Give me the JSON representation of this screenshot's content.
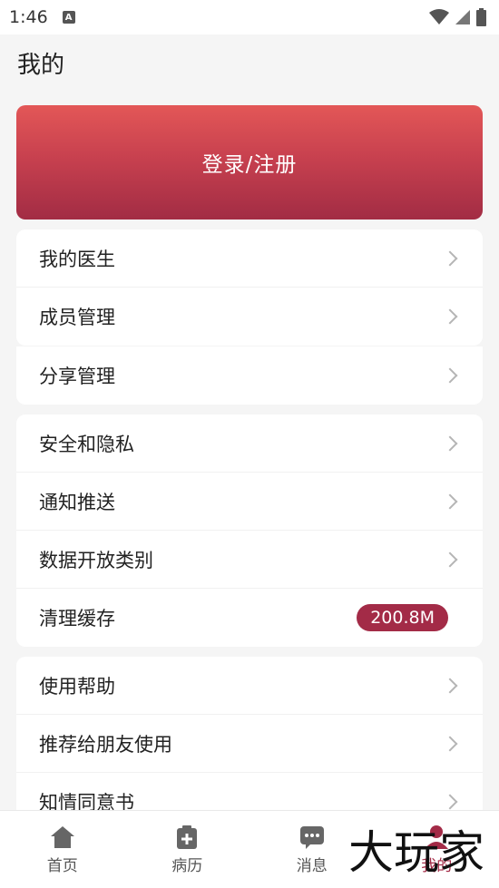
{
  "status_bar": {
    "time": "1:46",
    "notification_icon": "A"
  },
  "page": {
    "title": "我的"
  },
  "login": {
    "label": "登录/注册"
  },
  "menu_group_1": [
    {
      "label": "我的医生",
      "icon": "chevron-right-icon"
    },
    {
      "label": "成员管理",
      "icon": "chevron-right-icon"
    },
    {
      "label": "分享管理",
      "icon": "chevron-right-icon"
    }
  ],
  "menu_group_2": [
    {
      "label": "安全和隐私",
      "icon": "chevron-right-icon"
    },
    {
      "label": "通知推送",
      "icon": "chevron-right-icon"
    },
    {
      "label": "数据开放类别",
      "icon": "chevron-right-icon"
    },
    {
      "label": "清理缓存",
      "badge": "200.8M"
    }
  ],
  "menu_group_3": [
    {
      "label": "使用帮助",
      "icon": "chevron-right-icon"
    },
    {
      "label": "推荐给朋友使用",
      "icon": "chevron-right-icon"
    },
    {
      "label": "知情同意书",
      "icon": "chevron-right-icon"
    }
  ],
  "tab_bar": [
    {
      "label": "首页",
      "icon": "home-icon"
    },
    {
      "label": "病历",
      "icon": "medical-record-icon"
    },
    {
      "label": "消息",
      "icon": "message-icon"
    },
    {
      "label": "我的",
      "icon": "profile-icon"
    }
  ],
  "watermark": {
    "text": "大玩家"
  },
  "colors": {
    "accent": "#a32b47",
    "banner_top": "#e35757",
    "banner_bottom": "#a22c44"
  }
}
